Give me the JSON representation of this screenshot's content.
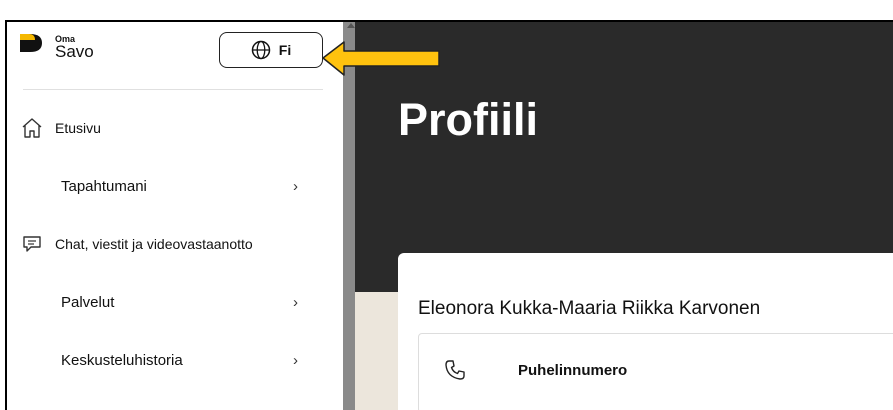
{
  "logo": {
    "small": "Oma",
    "name": "Savo"
  },
  "language_button": {
    "label": "Fi",
    "icon": "globe-icon"
  },
  "sidebar": {
    "items": [
      {
        "label": "Etusivu",
        "icon": "home-icon"
      },
      {
        "label": "Tapahtumani",
        "chevron": "›"
      },
      {
        "label": "Chat, viestit ja videovastaanotto",
        "icon": "chat-icon"
      },
      {
        "label": "Palvelut",
        "chevron": "›"
      },
      {
        "label": "Keskusteluhistoria",
        "chevron": "›"
      }
    ]
  },
  "main": {
    "title": "Profiili",
    "profile_name": "Eleonora Kukka-Maaria Riikka Karvonen",
    "phone_label": "Puhelinnumero"
  },
  "colors": {
    "hero_bg": "#2a2a2a",
    "page_bg": "#ece6dc",
    "brand_yellow": "#f5b800",
    "arrow_fill": "#ffc20e"
  }
}
